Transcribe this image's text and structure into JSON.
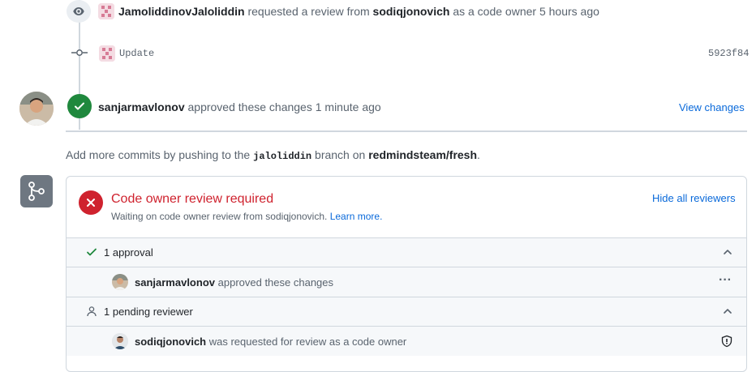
{
  "timeline": {
    "review_request": {
      "actor": "JamoliddinovJaloliddin",
      "text": "requested a review from",
      "reviewer": "sodiqjonovich",
      "suffix": "as a code owner 5 hours ago"
    },
    "commit": {
      "message": "Update",
      "sha": "5923f84"
    },
    "approval": {
      "actor": "sanjarmavlonov",
      "text": "approved these changes 1 minute ago",
      "view_changes": "View changes"
    }
  },
  "push_hint": {
    "prefix": "Add more commits by pushing to the",
    "branch": "jaloliddin",
    "middle": "branch on",
    "repo": "redmindsteam/fresh",
    "end": "."
  },
  "merge_box": {
    "title": "Code owner review required",
    "subtitle": "Waiting on code owner review from sodiqjonovich.",
    "learn_more": "Learn more.",
    "hide_reviewers": "Hide all reviewers",
    "approvals_header": "1 approval",
    "approval_row": {
      "user": "sanjarmavlonov",
      "text": "approved these changes",
      "menu": "···"
    },
    "pending_header": "1 pending reviewer",
    "pending_row": {
      "user": "sodiqjonovich",
      "text": "was requested for review as a code owner"
    }
  },
  "colors": {
    "accent": "#0969da",
    "success": "#1f883d",
    "danger": "#cf222e"
  }
}
